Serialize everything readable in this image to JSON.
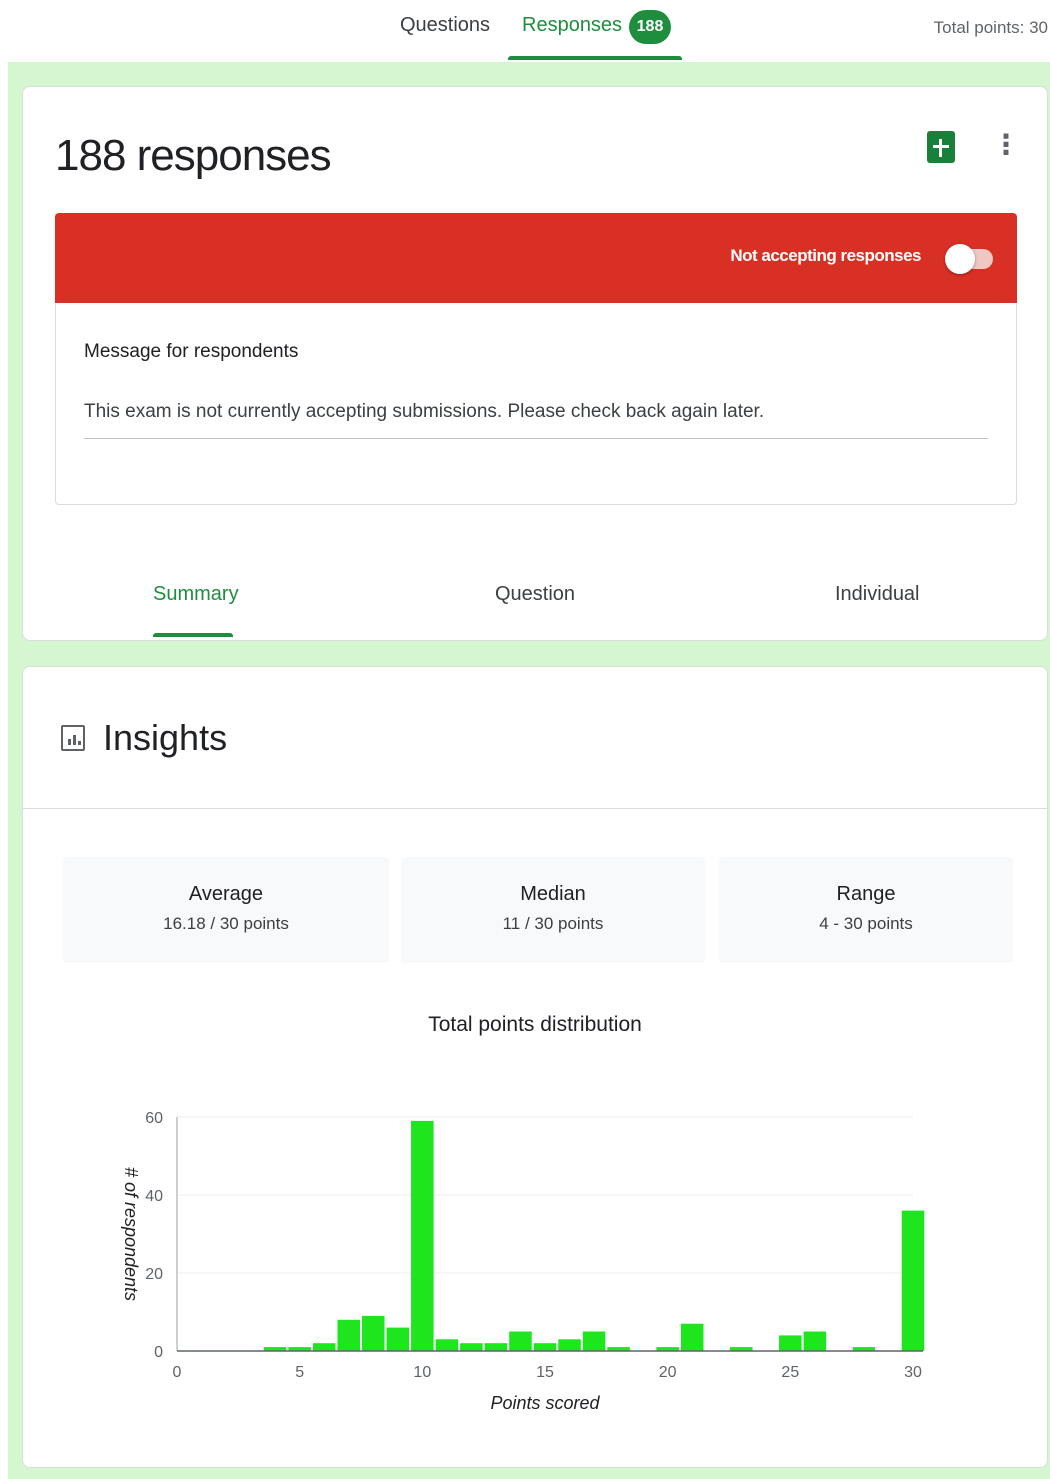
{
  "nav": {
    "tabs": [
      {
        "label": "Questions"
      },
      {
        "label": "Responses",
        "badge": "188"
      }
    ],
    "total_points": "Total points: 30"
  },
  "responses_card": {
    "title": "188 responses",
    "status_text": "Not accepting responses",
    "accepting": false,
    "message_label": "Message for respondents",
    "message_value": "This exam is not currently accepting submissions. Please check back again later.",
    "subtabs": [
      {
        "label": "Summary"
      },
      {
        "label": "Question"
      },
      {
        "label": "Individual"
      }
    ],
    "active_subtab": "Summary"
  },
  "insights": {
    "title": "Insights",
    "stats": [
      {
        "label": "Average",
        "value": "16.18 / 30 points"
      },
      {
        "label": "Median",
        "value": "11 / 30 points"
      },
      {
        "label": "Range",
        "value": "4 - 30 points"
      }
    ]
  },
  "colors": {
    "accent_green": "#1e8e3e",
    "bar_green": "#1ee51e",
    "banner_red": "#d93025",
    "backdrop": "#d4f7cf"
  },
  "chart_data": {
    "type": "bar",
    "title": "Total points distribution",
    "xlabel": "Points scored",
    "ylabel": "# of respondents",
    "x": [
      4,
      5,
      6,
      7,
      8,
      9,
      10,
      11,
      12,
      13,
      14,
      15,
      16,
      17,
      18,
      19,
      20,
      21,
      22,
      23,
      24,
      25,
      26,
      27,
      28,
      29,
      30
    ],
    "values": [
      1,
      1,
      2,
      8,
      9,
      6,
      59,
      3,
      2,
      2,
      5,
      2,
      3,
      5,
      1,
      0,
      1,
      7,
      0,
      1,
      0,
      4,
      5,
      0,
      1,
      0,
      36
    ],
    "xlim": [
      0,
      30
    ],
    "ylim": [
      0,
      60
    ],
    "xticks": [
      0,
      5,
      10,
      15,
      20,
      25,
      30
    ],
    "yticks": [
      0,
      20,
      40,
      60
    ],
    "grid": true
  }
}
